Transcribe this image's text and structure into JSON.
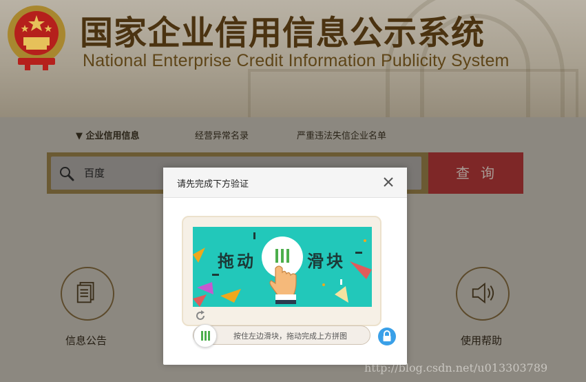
{
  "header": {
    "title_cn": "国家企业信用信息公示系统",
    "title_en": "National Enterprise Credit Information Publicity System"
  },
  "tabs": [
    {
      "label": "▼  企业信用信息",
      "active": true
    },
    {
      "label": "经营异常名录",
      "active": false
    },
    {
      "label": "严重违法失信企业名单",
      "active": false
    }
  ],
  "search": {
    "value": "百度",
    "button_label": "查询"
  },
  "shortcuts": [
    {
      "label": "信息公告",
      "icon": "document-icon"
    },
    {
      "label": "使用帮助",
      "icon": "speaker-icon"
    }
  ],
  "modal": {
    "title": "请先完成下方验证",
    "puzzle_text_left": "拖动",
    "puzzle_text_right": "滑块",
    "slider_hint": "按住左边滑块，拖动完成上方拼图"
  },
  "watermark": "http://blog.csdn.net/u013303789",
  "colors": {
    "puzzle_bg": "#22c8ba",
    "query_button": "#7e2727",
    "lock": "#3aa0e8"
  }
}
